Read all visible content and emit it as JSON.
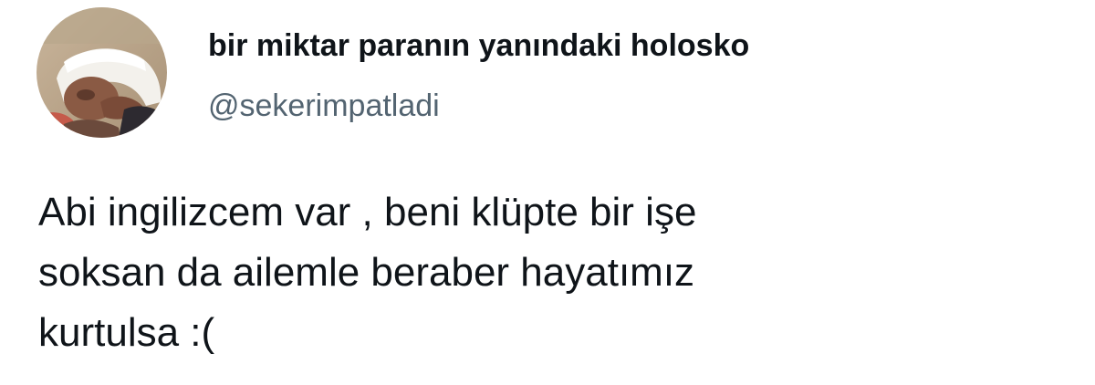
{
  "tweet": {
    "author_name": "bir miktar paranın yanındaki holosko",
    "author_handle": "@sekerimpatladi",
    "text_lines": [
      "Abi ingilizcem var , beni klüpte bir işe",
      "soksan da ailemle beraber hayatımız",
      "kurtulsa :("
    ],
    "avatar_icon": "profile-photo-woman-white-headscarf"
  }
}
